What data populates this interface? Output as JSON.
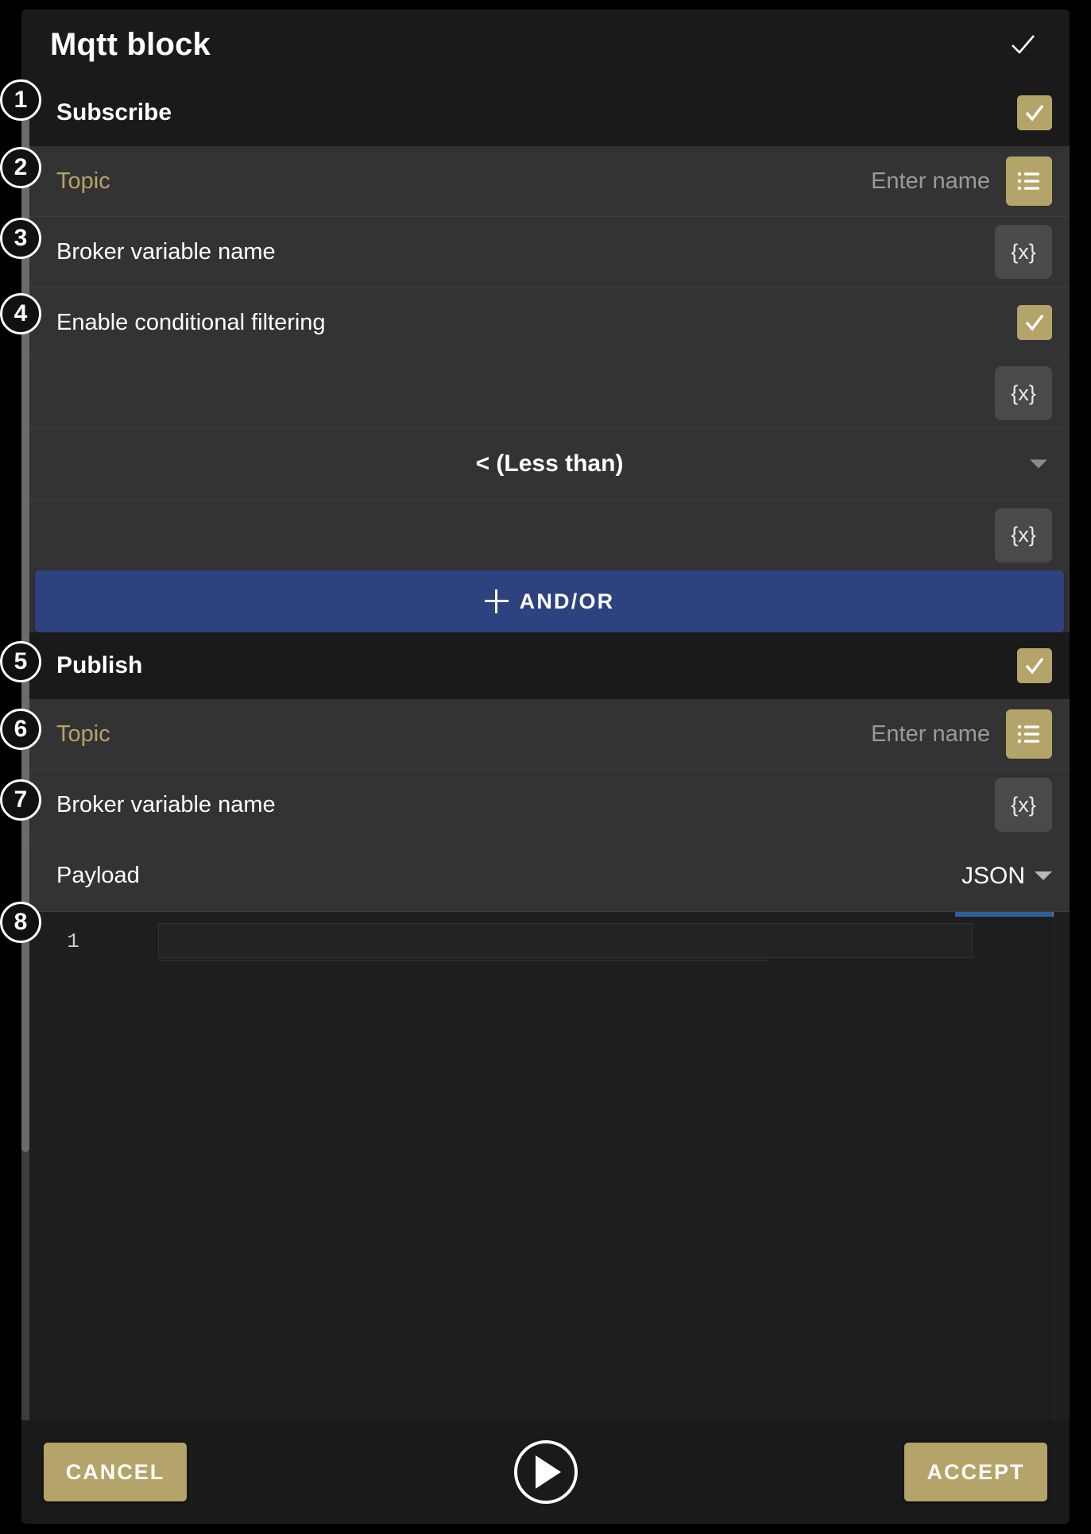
{
  "dialog": {
    "title": "Mqtt block",
    "confirm_icon": "check-icon"
  },
  "subscribe": {
    "header_label": "Subscribe",
    "enabled": true,
    "topic": {
      "label": "Topic",
      "placeholder": "Enter name",
      "value": "",
      "picker_icon": "list-icon"
    },
    "broker_variable": {
      "label": "Broker variable name",
      "variable_icon": "{x}"
    },
    "conditional": {
      "label": "Enable conditional filtering",
      "enabled": true,
      "operand_left_icon": "{x}",
      "operator": "< (Less than)",
      "operand_right_icon": "{x}"
    },
    "andor_button": {
      "label": "AND/OR",
      "plus_icon": "plus-icon",
      "color": "#2e4280"
    }
  },
  "publish": {
    "header_label": "Publish",
    "enabled": true,
    "topic": {
      "label": "Topic",
      "placeholder": "Enter name",
      "value": "",
      "picker_icon": "list-icon"
    },
    "broker_variable": {
      "label": "Broker variable name",
      "variable_icon": "{x}"
    },
    "payload": {
      "label": "Payload",
      "format": "JSON",
      "editor": {
        "line_numbers": [
          "1"
        ],
        "content": ""
      }
    }
  },
  "footer": {
    "cancel_label": "CANCEL",
    "accept_label": "ACCEPT",
    "run_icon": "play-icon"
  },
  "annotations": {
    "items": [
      "1",
      "2",
      "3",
      "4",
      "5",
      "6",
      "7",
      "8"
    ]
  },
  "colors": {
    "accent_gold": "#b5a469",
    "blue_button": "#2e4280",
    "row_bg": "#333333",
    "header_bg": "#1a1a1a",
    "editor_bg": "#1e1e1e"
  }
}
